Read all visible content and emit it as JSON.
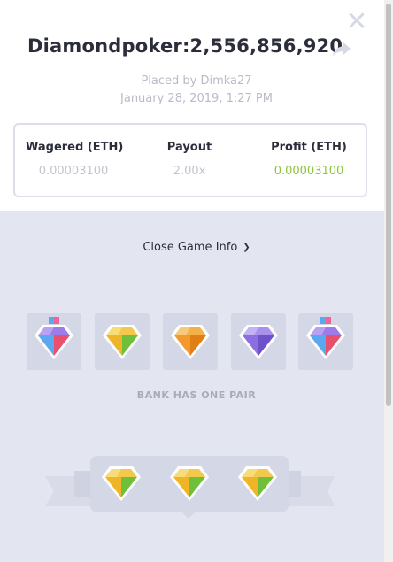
{
  "header": {
    "title": "Diamondpoker:2,556,856,920",
    "placed_by": "Placed by Dimka27",
    "date": "January 28, 2019, 1:27 PM",
    "close_icon": "close-icon",
    "share_icon": "share-arrow-icon"
  },
  "stats": {
    "wagered_label": "Wagered (ETH)",
    "wagered_value": "0.00003100",
    "payout_label": "Payout",
    "payout_value": "2.00x",
    "profit_label": "Profit (ETH)",
    "profit_value": "0.00003100",
    "profit_color": "#8cc63f"
  },
  "toggle": {
    "label": "Close Game Info"
  },
  "player_gems": [
    {
      "color": "multicolor",
      "tag": true
    },
    {
      "color": "yellow-green",
      "tag": false
    },
    {
      "color": "orange",
      "tag": false
    },
    {
      "color": "purple",
      "tag": false
    },
    {
      "color": "multicolor",
      "tag": true
    }
  ],
  "result": {
    "text": "BANK HAS ONE PAIR"
  },
  "bank_gems": [
    "yellow-green",
    "yellow-green",
    "yellow-green"
  ]
}
